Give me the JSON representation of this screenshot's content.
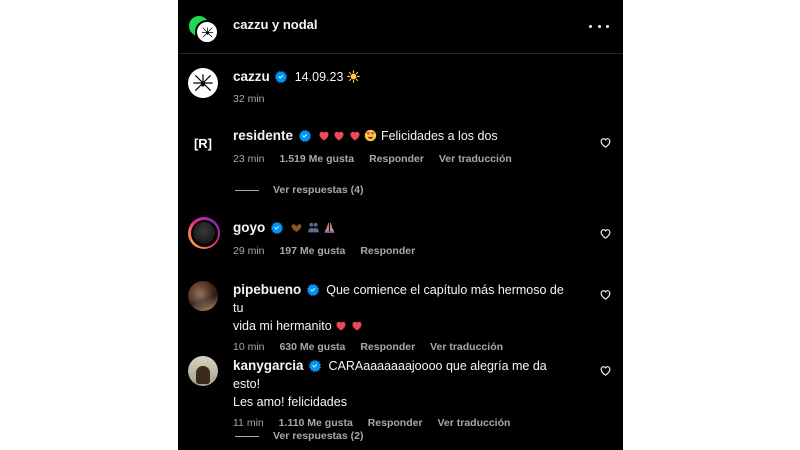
{
  "header": {
    "title": "cazzu y nodal"
  },
  "post": {
    "username": "cazzu",
    "caption": "14.09.23",
    "time": "32 min"
  },
  "comments": [
    {
      "username": "residente",
      "avatar_text": "[R]",
      "text": "Felicidades a los dos",
      "time": "23 min",
      "likes": "1.519 Me gusta",
      "reply": "Responder",
      "translate": "Ver traducción",
      "view_replies": "Ver respuestas (4)"
    },
    {
      "username": "goyo",
      "text": "",
      "time": "29 min",
      "likes": "197 Me gusta",
      "reply": "Responder"
    },
    {
      "username": "pipebueno",
      "text_line1": "Que comience el capítulo más hermoso de tu",
      "text_line2": "vida mi hermanito",
      "time": "10 min",
      "likes": "630 Me gusta",
      "reply": "Responder",
      "translate": "Ver traducción"
    },
    {
      "username": "kanygarcia",
      "text_line1": "CARAaaaaaaajoooo que alegría me da esto!",
      "text_line2": "Les amo! felicidades",
      "time": "11 min",
      "likes": "1.110 Me gusta",
      "reply": "Responder",
      "translate": "Ver traducción",
      "view_replies": "Ver respuestas (2)"
    }
  ],
  "colors": {
    "background": "#000000",
    "verified": "#0095f6",
    "muted": "#a8a8a8",
    "heart": "#ed4956"
  }
}
